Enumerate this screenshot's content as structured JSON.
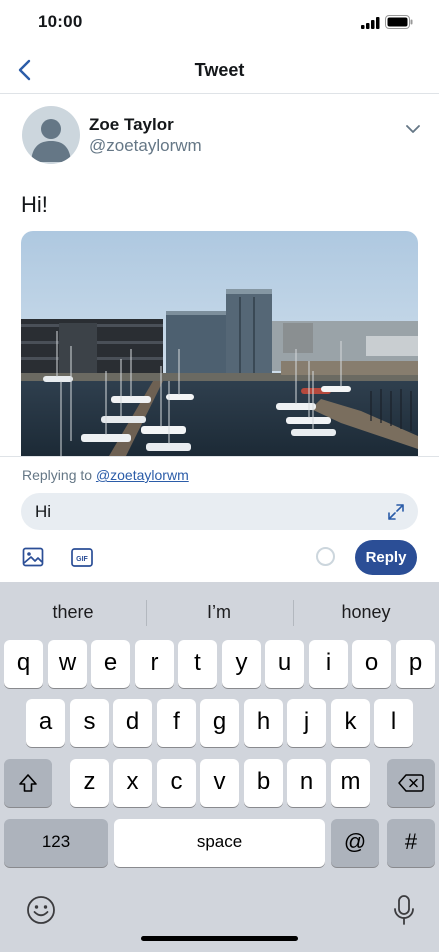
{
  "status_bar": {
    "time": "10:00"
  },
  "nav": {
    "title": "Tweet"
  },
  "tweet": {
    "author_name": "Zoe Taylor",
    "author_handle": "@zoetaylorwm",
    "text": "Hi!"
  },
  "reply": {
    "replying_to_prefix": "Replying to ",
    "replying_to_handle": "@zoetaylorwm",
    "input_value": "Hi",
    "reply_button": "Reply",
    "gif_label": "GIF"
  },
  "keyboard": {
    "suggestions": [
      "there",
      "I’m",
      "honey"
    ],
    "row1": [
      "q",
      "w",
      "e",
      "r",
      "t",
      "y",
      "u",
      "i",
      "o",
      "p"
    ],
    "row2": [
      "a",
      "s",
      "d",
      "f",
      "g",
      "h",
      "j",
      "k",
      "l"
    ],
    "row3": [
      "z",
      "x",
      "c",
      "v",
      "b",
      "n",
      "m"
    ],
    "numbers_key": "123",
    "space_key": "space",
    "at_key": "@",
    "hash_key": "#"
  },
  "colors": {
    "accent": "#2b4e96",
    "keyboard_bg": "#d1d5dc"
  }
}
